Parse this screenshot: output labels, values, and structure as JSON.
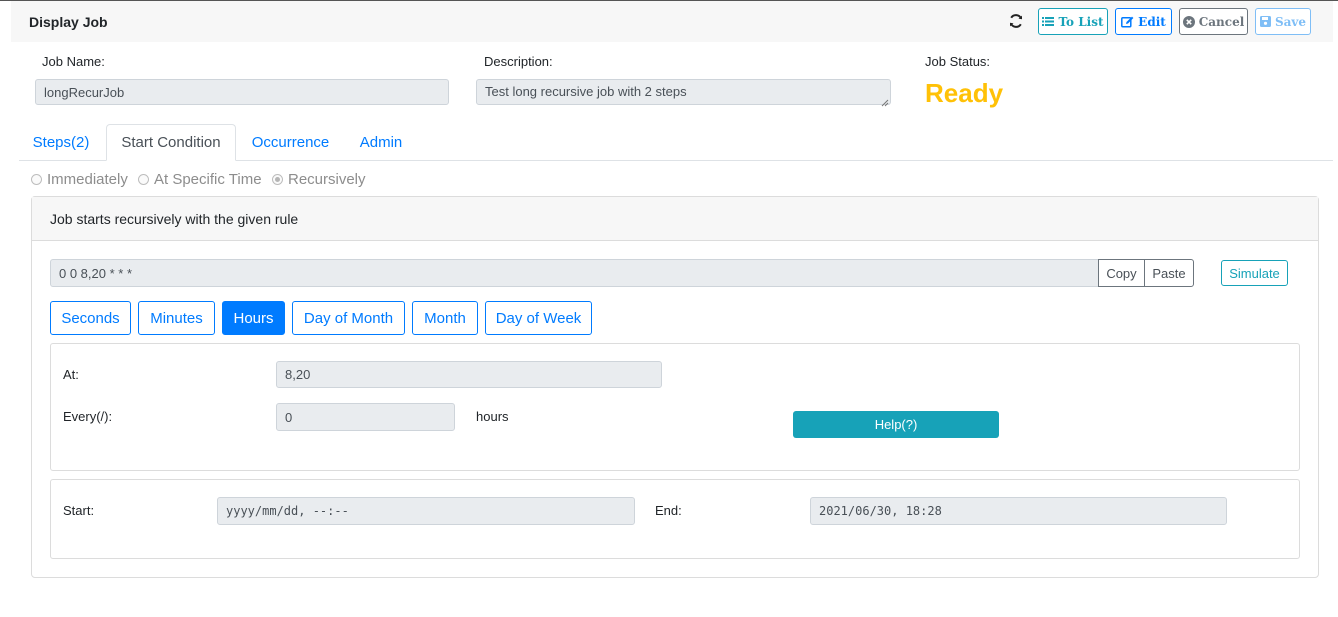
{
  "header": {
    "title": "Display Job",
    "buttons": {
      "to_list": "To List",
      "edit": "Edit",
      "cancel": "Cancel",
      "save": "Save"
    }
  },
  "job": {
    "name_label": "Job Name:",
    "name_value": "longRecurJob",
    "description_label": "Description:",
    "description_value": "Test long recursive job with 2 steps",
    "status_label": "Job Status:",
    "status_value": "Ready"
  },
  "tabs": [
    {
      "label": "Steps(2)",
      "active": false
    },
    {
      "label": "Start Condition",
      "active": true
    },
    {
      "label": "Occurrence",
      "active": false
    },
    {
      "label": "Admin",
      "active": false
    }
  ],
  "start_condition": {
    "options": [
      {
        "label": "Immediately",
        "selected": false
      },
      {
        "label": "At Specific Time",
        "selected": false
      },
      {
        "label": "Recursively",
        "selected": true
      }
    ],
    "card_title": "Job starts recursively with the given rule",
    "cron_expression": "0 0 8,20 * * *",
    "copy_label": "Copy",
    "paste_label": "Paste",
    "simulate_label": "Simulate",
    "field_tabs": [
      {
        "label": "Seconds",
        "active": false
      },
      {
        "label": "Minutes",
        "active": false
      },
      {
        "label": "Hours",
        "active": true
      },
      {
        "label": "Day of Month",
        "active": false
      },
      {
        "label": "Month",
        "active": false
      },
      {
        "label": "Day of Week",
        "active": false
      }
    ],
    "at_label": "At:",
    "at_value": "8,20",
    "every_label": "Every(/):",
    "every_value": "0",
    "every_unit": "hours",
    "help_label": "Help(?)",
    "start_label": "Start:",
    "start_placeholder": "yyyy/mm/dd, --:--",
    "end_label": "End:",
    "end_value": "2021/06/30, 18:28"
  },
  "colors": {
    "primary": "#007bff",
    "info": "#17a2b8",
    "secondary": "#6c757d",
    "warning": "#ffc107"
  }
}
